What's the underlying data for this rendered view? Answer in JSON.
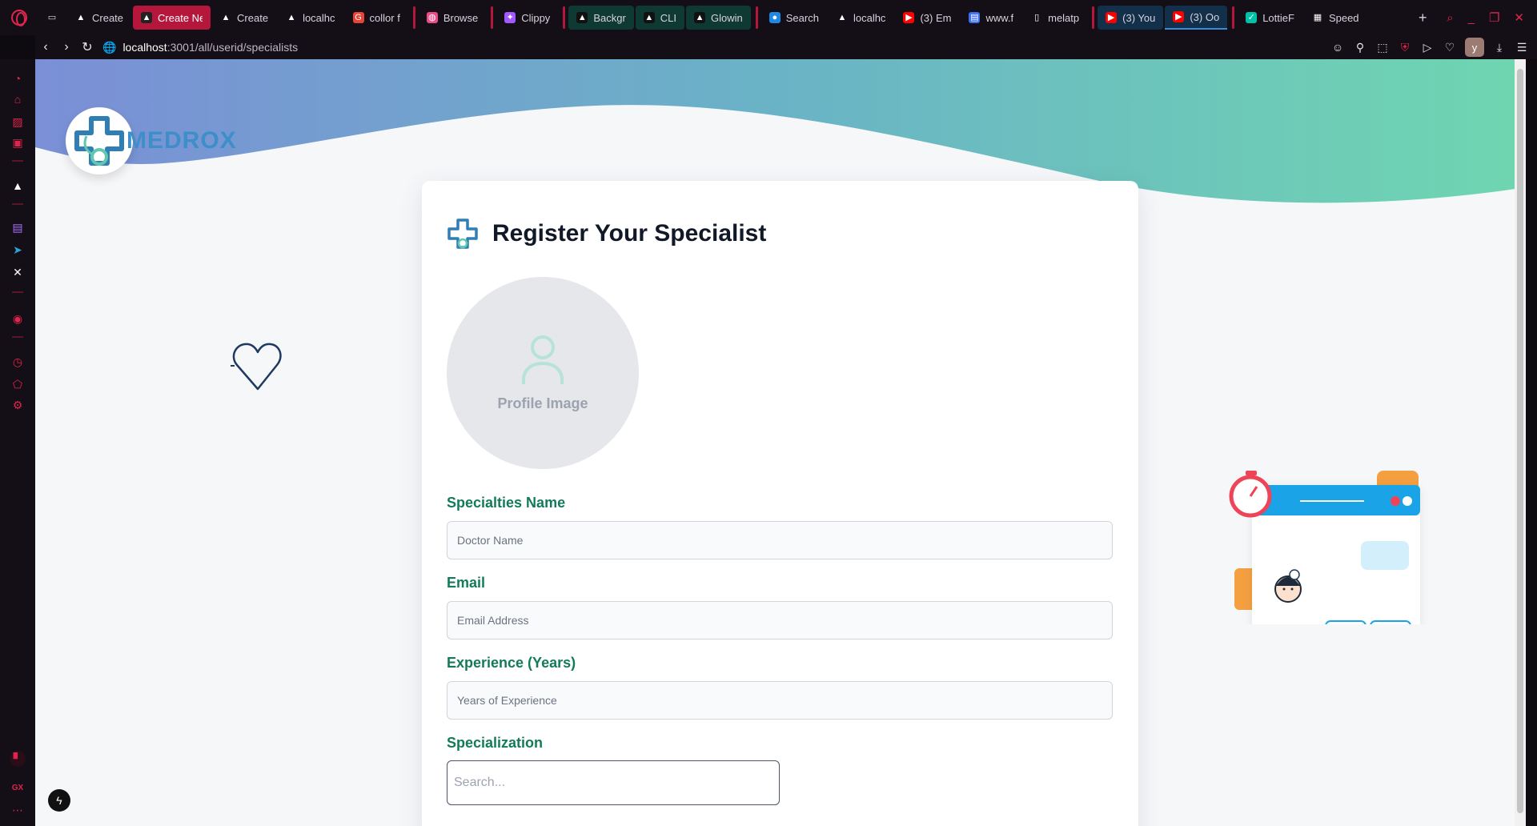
{
  "browser": {
    "tabs": [
      {
        "label": "Create",
        "favicon": "triangle-icon",
        "style": ""
      },
      {
        "label": "Create Next A",
        "favicon": "nextjs-icon",
        "style": "active"
      },
      {
        "label": "Create",
        "favicon": "triangle-icon",
        "style": ""
      },
      {
        "label": "localhc",
        "favicon": "triangle-icon",
        "style": ""
      },
      {
        "label": "collor f",
        "favicon": "google-icon",
        "style": ""
      },
      {
        "label": "Browse",
        "favicon": "dribbble-icon",
        "style": "sep-before"
      },
      {
        "label": "Clippy",
        "favicon": "figma-icon",
        "style": "sep-before"
      },
      {
        "label": "Backgr",
        "favicon": "aceternity-icon",
        "style": "green sep-before"
      },
      {
        "label": "CLI",
        "favicon": "aceternity-icon",
        "style": "green"
      },
      {
        "label": "Glowin",
        "favicon": "aceternity-icon",
        "style": "green"
      },
      {
        "label": "Search",
        "favicon": "globe-icon",
        "style": "sep-before"
      },
      {
        "label": "localhc",
        "favicon": "triangle-icon",
        "style": ""
      },
      {
        "label": "(3) Em",
        "favicon": "youtube-icon",
        "style": ""
      },
      {
        "label": "www.f",
        "favicon": "doc-icon",
        "style": ""
      },
      {
        "label": "melatp",
        "favicon": "file-icon",
        "style": ""
      },
      {
        "label": "(3) You",
        "favicon": "youtube-icon",
        "style": "blue sep-before"
      },
      {
        "label": "(3) Oo",
        "favicon": "youtube-icon",
        "style": "blue underline"
      },
      {
        "label": "LottieF",
        "favicon": "lottie-icon",
        "style": "sep-before"
      },
      {
        "label": "Speed",
        "favicon": "grid-icon",
        "style": ""
      }
    ],
    "url_host": "localhost",
    "url_path": ":3001/all/userid/specialists",
    "profile_initial": "y"
  },
  "colors": {
    "accent": "#b4163c",
    "brand_green": "#137a5a",
    "wave_left": "#7b8fd6",
    "wave_right": "#6fd6b0"
  },
  "page": {
    "logo_text": "MEDROX",
    "card": {
      "title": "Register Your Specialist",
      "avatar_label": "Profile Image",
      "fields": {
        "name_label": "Specialties Name",
        "name_placeholder": "Doctor Name",
        "email_label": "Email",
        "email_placeholder": "Email Address",
        "experience_label": "Experience (Years)",
        "experience_placeholder": "Years of Experience",
        "specialization_label": "Specialization",
        "specialization_placeholder": "Search..."
      }
    }
  }
}
